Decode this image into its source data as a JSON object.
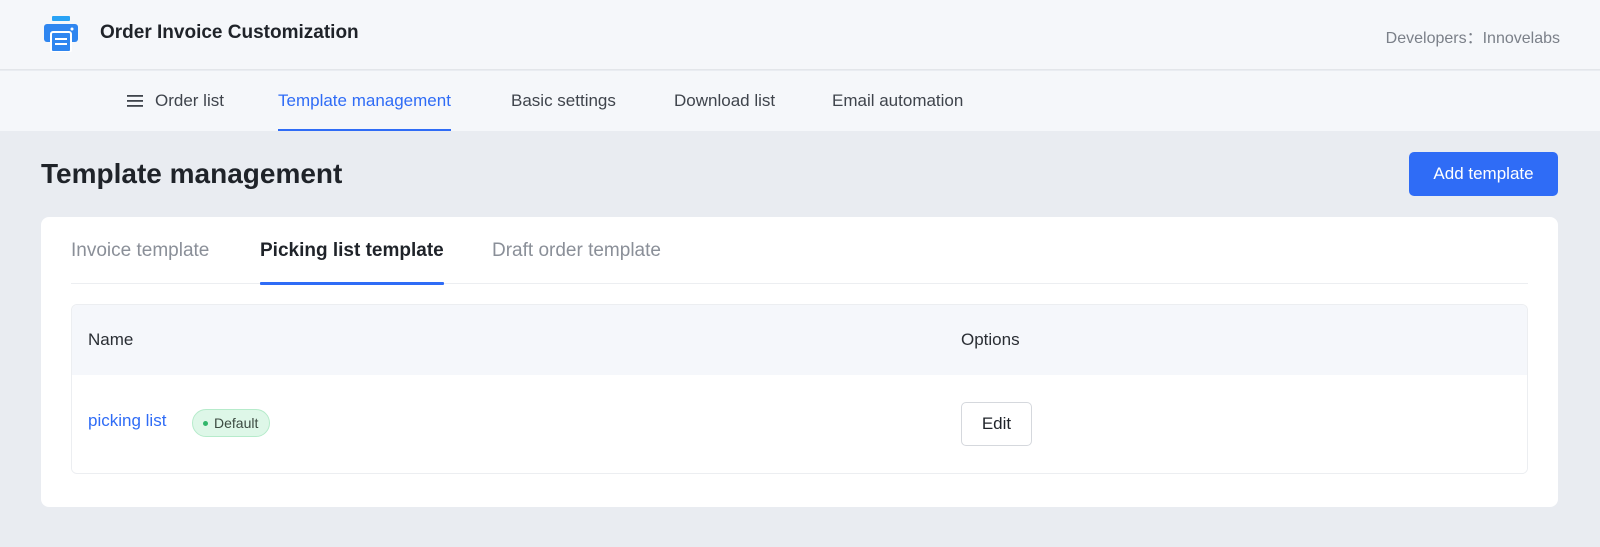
{
  "header": {
    "app_title": "Order Invoice Customization",
    "developer_info": "Developers：Innovelabs",
    "logo_icon": "printer-icon",
    "colors": {
      "accent": "#2f6cf6",
      "logo": "#29a3f5"
    }
  },
  "nav": {
    "items": [
      {
        "label": "Order list",
        "icon": "menu-icon"
      },
      {
        "label": "Template management",
        "active": true
      },
      {
        "label": "Basic settings"
      },
      {
        "label": "Download list"
      },
      {
        "label": "Email automation"
      }
    ]
  },
  "page": {
    "title": "Template management",
    "add_button_label": "Add template"
  },
  "tabs": [
    {
      "label": "Invoice template"
    },
    {
      "label": "Picking list template",
      "active": true
    },
    {
      "label": "Draft order template"
    }
  ],
  "table": {
    "columns": [
      "Name",
      "Options"
    ],
    "rows": [
      {
        "name": "picking list",
        "badge": "Default",
        "action": "Edit"
      }
    ]
  }
}
